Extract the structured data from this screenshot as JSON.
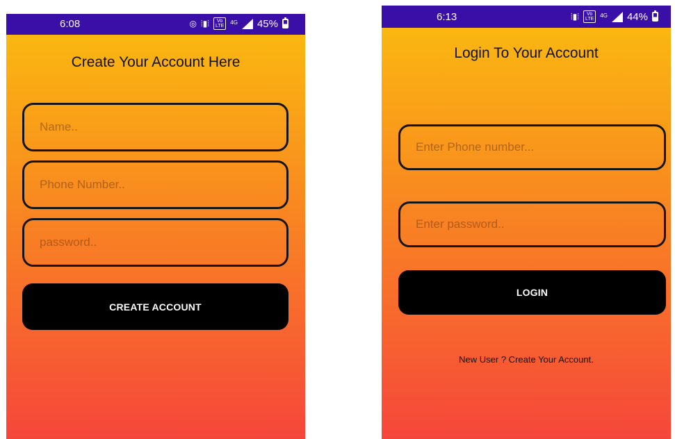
{
  "signup_screen": {
    "status_bar": {
      "time": "6:08",
      "battery": "45%"
    },
    "title": "Create Your Account Here",
    "name_placeholder": "Name..",
    "phone_placeholder": "Phone Number..",
    "password_placeholder": "password..",
    "create_button_label": "CREATE ACCOUNT"
  },
  "login_screen": {
    "status_bar": {
      "time": "6:13",
      "battery": "44%"
    },
    "title": "Login To Your Account",
    "phone_placeholder": "Enter Phone number...",
    "password_placeholder": "Enter password..",
    "login_button_label": "LOGIN",
    "create_account_link": "New User ? Create Your Account."
  },
  "status_icons": {
    "hotspot": "hotspot-icon",
    "vibrate": "vibrate-icon",
    "volte": "VoLTE",
    "network": "4G",
    "signal": "signal-icon",
    "battery": "battery-icon"
  },
  "colors": {
    "status_bar": "#3a0fa8",
    "gradient_top": "#fbbd0f",
    "gradient_bottom": "#f5463b",
    "button": "#000000",
    "button_text": "#ffffff"
  }
}
